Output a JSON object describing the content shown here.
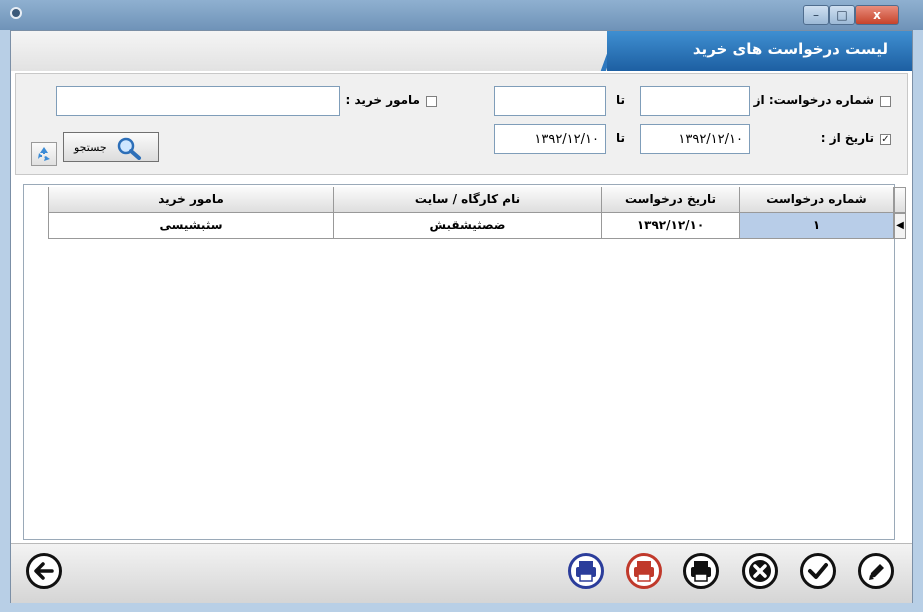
{
  "window": {
    "minimize_glyph": "–",
    "maximize_glyph": "□",
    "close_glyph": "x"
  },
  "header": {
    "title": "لیست درخواست های خرید"
  },
  "filters": {
    "request_number_label": "شماره درخواست: از",
    "request_number_checked": false,
    "request_from_value": "",
    "request_to_label": "تا",
    "request_to_value": "",
    "date_from_label": "تاریخ از :",
    "date_checked": true,
    "date_from_value": "۱۳۹۲/۱۲/۱۰",
    "date_to_label": "تا",
    "date_to_value": "۱۳۹۲/۱۲/۱۰",
    "buyer_label": "مامور خرید :",
    "buyer_checked": false,
    "buyer_value": "",
    "search_label": "جستجو"
  },
  "table": {
    "columns": [
      "شماره درخواست",
      "تاریخ درخواست",
      "نام کارگاه / سایت",
      "مامور خرید"
    ],
    "rows": [
      [
        "۱",
        "۱۳۹۲/۱۲/۱۰",
        "ضصثیشقبش",
        "سثبشیسی"
      ]
    ]
  },
  "toolbar": {
    "icons": [
      "edit-icon",
      "confirm-icon",
      "cancel-icon",
      "print-icon",
      "print-red-icon",
      "print-blue-icon",
      "back-icon"
    ]
  },
  "colors": {
    "header_blue": "#1d5fa2",
    "selected_cell": "#b8cde8",
    "print_red": "#c0392b",
    "print_blue": "#2b3d9b"
  }
}
